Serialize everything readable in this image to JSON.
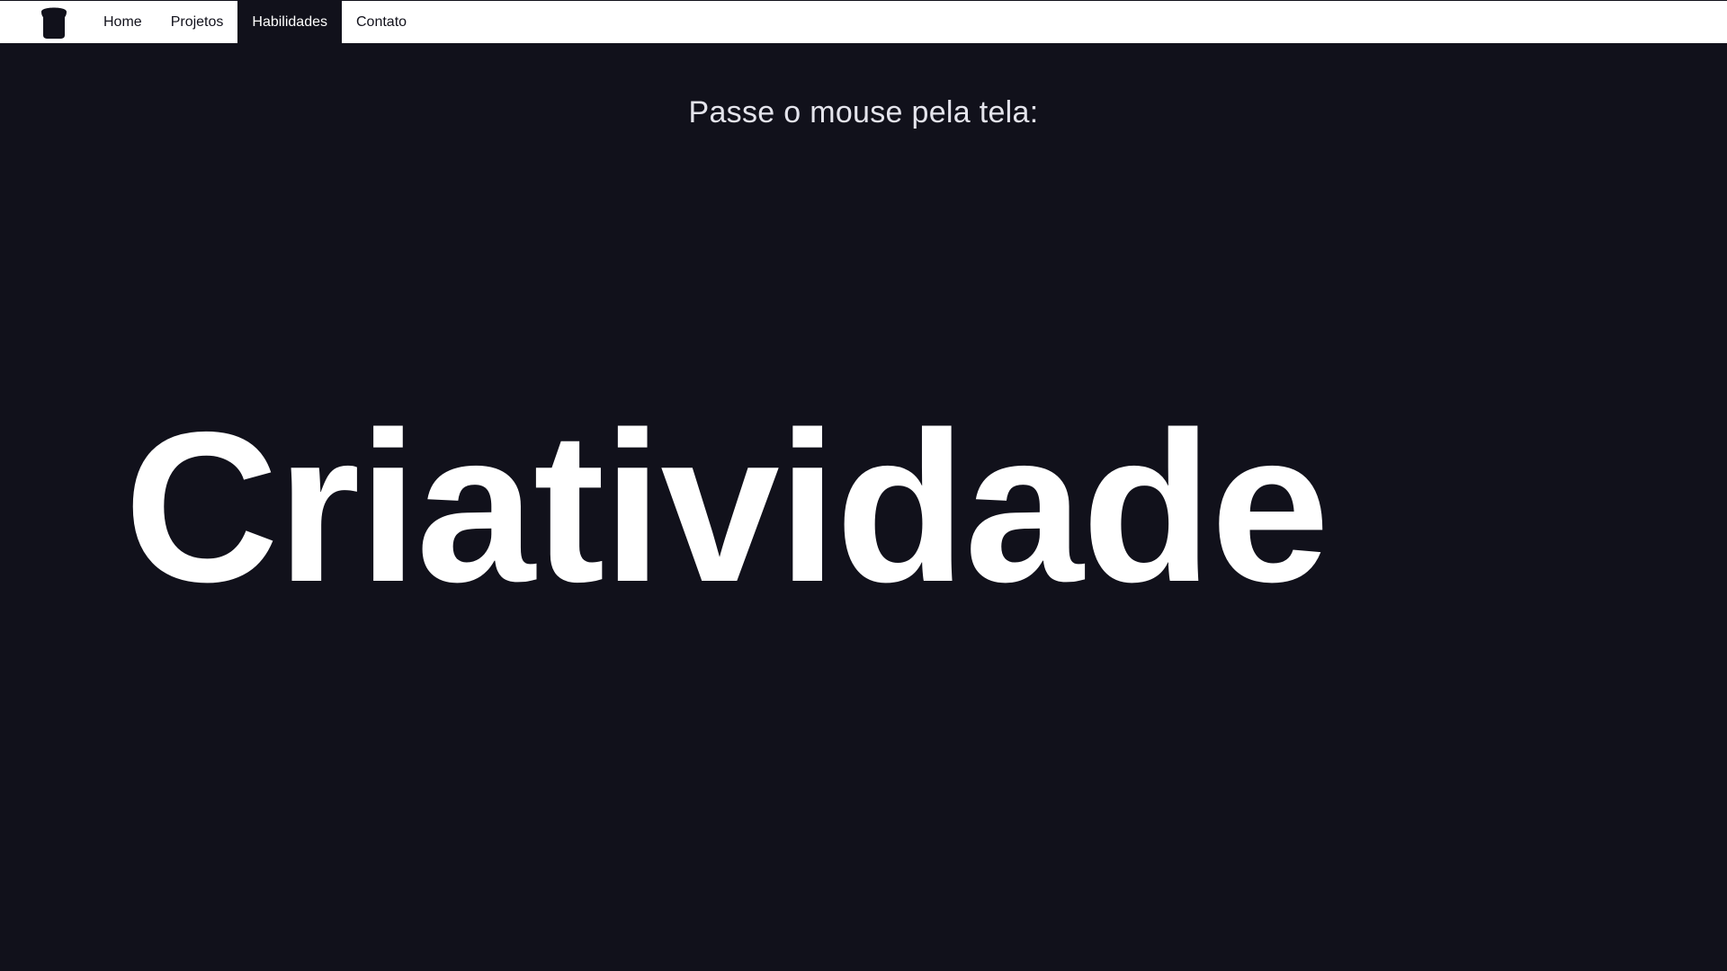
{
  "nav": {
    "logo_icon": "bread-icon",
    "items": [
      {
        "label": "Home",
        "active": false
      },
      {
        "label": "Projetos",
        "active": false
      },
      {
        "label": "Habilidades",
        "active": true
      },
      {
        "label": "Contato",
        "active": false
      }
    ]
  },
  "main": {
    "hint": "Passe o mouse pela tela:",
    "hero_word": "Criatividade"
  },
  "colors": {
    "background": "#11111b",
    "navbar": "#ffffff",
    "text_light": "#ffffff"
  }
}
